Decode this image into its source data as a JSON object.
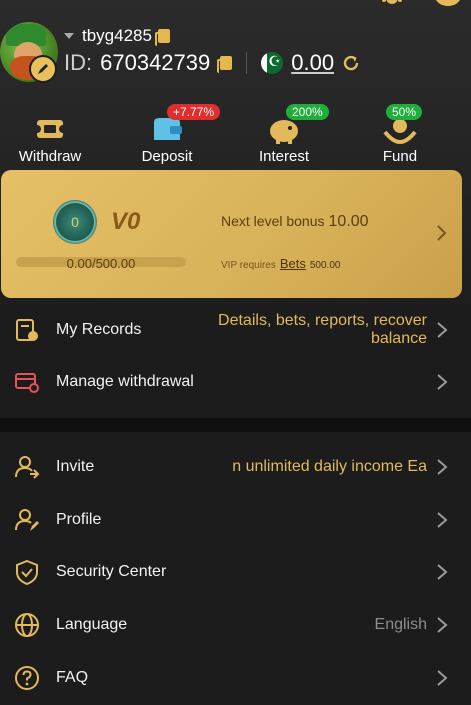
{
  "user": {
    "name": "tbyg4285",
    "id_label": "ID:",
    "id_value": "670342739",
    "balance": "0.00"
  },
  "quick_actions": [
    {
      "label": "Withdraw",
      "icon": "ticket-icon"
    },
    {
      "label": "Deposit",
      "icon": "wallet-icon",
      "badge": "+7.77%",
      "badge_color": "#e02d2d"
    },
    {
      "label": "Interest",
      "icon": "piggy-bank-icon",
      "badge": "200%",
      "badge_color": "#1fae3a"
    },
    {
      "label": "Fund",
      "icon": "hands-coin-icon",
      "badge": "50%",
      "badge_color": "#1fae3a"
    }
  ],
  "vip": {
    "level": "V0",
    "medal_text": "0",
    "progress_text": "0.00/500.00",
    "progress_fraction": 0,
    "next_label": "Next level bonus",
    "next_value": "10.00",
    "req_label": "VIP requires",
    "req_bets": "Bets",
    "req_amount": "500.00"
  },
  "menu_top": [
    {
      "label": "My Records",
      "value": "Details, bets, reports, recover balance",
      "icon": "records-icon"
    },
    {
      "label": "Manage withdrawal",
      "value": "",
      "icon": "card-gear-icon"
    }
  ],
  "menu_bottom": [
    {
      "label": "Invite",
      "value": "n unlimited daily income  Ea",
      "icon": "invite-icon"
    },
    {
      "label": "Profile",
      "value": "",
      "icon": "profile-icon"
    },
    {
      "label": "Security Center",
      "value": "",
      "icon": "shield-icon"
    },
    {
      "label": "Language",
      "value": "English",
      "icon": "globe-icon"
    },
    {
      "label": "FAQ",
      "value": "",
      "icon": "question-icon"
    }
  ],
  "colors": {
    "accent": "#e2b95b",
    "gold_card": "#dcb55d",
    "background": "#1c1c1c"
  }
}
